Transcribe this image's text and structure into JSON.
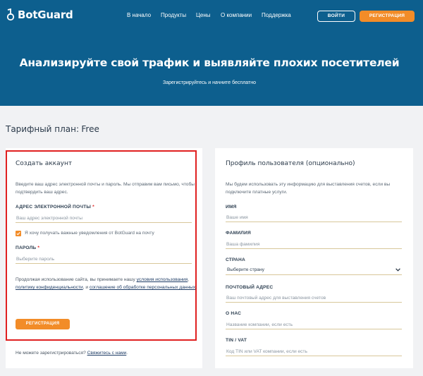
{
  "header": {
    "brand": "BotGuard",
    "nav": [
      "В начало",
      "Продукты",
      "Цены",
      "О компании",
      "Поддержка"
    ],
    "login_label": "ВОЙТИ",
    "register_label": "РЕГИСТРАЦИЯ"
  },
  "hero": {
    "title": "Анализируйте свой трафик и выявляйте плохих посетителей",
    "subtitle": "Зарегистрируйтесь и начните бесплатно"
  },
  "plan": {
    "label": "Тарифный план:",
    "value": "Free"
  },
  "account": {
    "title": "Создать аккаунт",
    "intro": "Введите ваш адрес электронной почты и пароль. Мы отправим вам письмо, чтобы подтвердить ваш адрес.",
    "email_label": "АДРЕС ЭЛЕКТРОННОЙ ПОЧТЫ",
    "email_required": "*",
    "email_placeholder": "Ваш адрес электронной почты",
    "notify_label": "Я хочу получать важные уведомления от BotGuard на почту",
    "password_label": "ПАРОЛЬ",
    "password_required": "*",
    "password_placeholder": "Выберите пароль",
    "terms_prefix": "Продолжая использование сайта, вы принимаете нашу",
    "terms_link1": "условия использования",
    "terms_sep1": ",",
    "terms_link2": "политику конфиденциальности",
    "terms_mid": ", и",
    "terms_link3": "соглашение об обработке персональных данных",
    "terms_end": ".",
    "submit_label": "РЕГИСТРАЦИЯ",
    "cant_register": "Не можете зарегистрироваться?",
    "contact_link": "Свяжитесь с нами",
    "contact_end": "."
  },
  "profile": {
    "title": "Профиль пользователя (опционально)",
    "intro": "Мы будем использовать эту информацию для выставления счетов, если вы подключите платные услуги.",
    "name_label": "ИМЯ",
    "name_placeholder": "Ваше имя",
    "surname_label": "ФАМИЛИЯ",
    "surname_placeholder": "Ваша фамилия",
    "country_label": "СТРАНА",
    "country_value": "Выберите страну",
    "address_label": "ПОЧТОВЫЙ АДРЕС",
    "address_placeholder": "Ваш почтовый адрес для выставления счетов",
    "about_label": "О НАС",
    "about_placeholder": "Название компании, если есть",
    "tin_label": "TIN / VAT",
    "tin_placeholder": "Код TIN или VAT компании, если есть"
  },
  "colors": {
    "header_bg": "#0d5f8e",
    "accent": "#f28c28",
    "highlight_border": "#e02020"
  }
}
